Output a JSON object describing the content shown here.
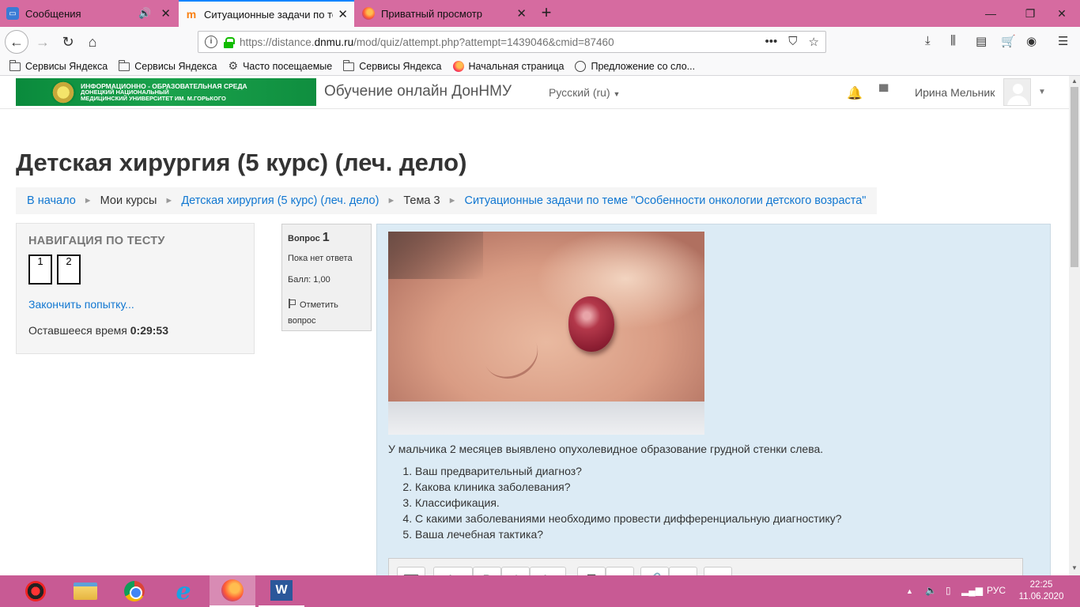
{
  "browser": {
    "tabs": [
      {
        "title": "Сообщения",
        "has_audio": true
      },
      {
        "title": "Ситуационные задачи по теме",
        "active": true
      },
      {
        "title": "Приватный просмотр"
      }
    ],
    "new_tab_glyph": "+",
    "url_host_prefix": "https://distance.",
    "url_host_bold": "dnmu.ru",
    "url_path": "/mod/quiz/attempt.php?attempt=1439046&cmid=87460",
    "bookmarks": [
      {
        "label": "Сервисы Яндекса",
        "icon": "folder-icon"
      },
      {
        "label": "Сервисы Яндекса",
        "icon": "folder-icon"
      },
      {
        "label": "Часто посещаемые",
        "icon": "gear-icon"
      },
      {
        "label": "Сервисы Яндекса",
        "icon": "folder-icon"
      },
      {
        "label": "Начальная страница",
        "icon": "firefox-icon"
      },
      {
        "label": "Предложение со сло...",
        "icon": "globe-icon"
      }
    ]
  },
  "site": {
    "logo_line1": "ИНФОРМАЦИОННО - ОБРАЗОВАТЕЛЬНАЯ СРЕДА",
    "logo_line2": "ДОНЕЦКИЙ НАЦИОНАЛЬНЫЙ",
    "logo_line3": "МЕДИЦИНСКИЙ УНИВЕРСИТЕТ ИМ. М.ГОРЬКОГО",
    "name": "Обучение онлайн ДонНМУ",
    "language": "Русский (ru)",
    "user_name": "Ирина Мельник"
  },
  "page": {
    "course_title": "Детская хирургия (5 курс) (леч. дело)",
    "breadcrumbs": [
      {
        "label": "В начало",
        "link": true
      },
      {
        "label": "Мои курсы",
        "link": false
      },
      {
        "label": "Детская хирургия (5 курс) (леч. дело)",
        "link": true
      },
      {
        "label": "Тема 3",
        "link": false
      },
      {
        "label": "Ситуационные задачи по теме \"Особенности онкологии детского возраста\"",
        "link": true
      }
    ]
  },
  "quiz_nav": {
    "heading": "НАВИГАЦИЯ ПО ТЕСТУ",
    "questions": [
      "1",
      "2"
    ],
    "finish_label": "Закончить попытку...",
    "time_label": "Оставшееся время",
    "time_value": "0:29:53"
  },
  "question": {
    "label": "Вопрос",
    "number": "1",
    "state": "Пока нет ответа",
    "mark": "Балл: 1,00",
    "flag_label": "Отметить",
    "flag_label2": "вопрос",
    "text": "У мальчика 2 месяцев выявлено опухолевидное образование грудной стенки слева.",
    "items": [
      "Ваш предварительный диагноз?",
      "Какова клиника заболевания?",
      "Классификация.",
      "С какими заболеваниями необходимо провести дифференциальную диагностику?",
      "Ваша лечебная тактика?"
    ]
  },
  "taskbar": {
    "lang": "РУС",
    "time": "22:25",
    "date": "11.06.2020"
  },
  "colors": {
    "tabstrip": "#d66ba0",
    "taskbar": "#c85a94",
    "link": "#1177d1",
    "question_bg": "#dcebf5"
  }
}
